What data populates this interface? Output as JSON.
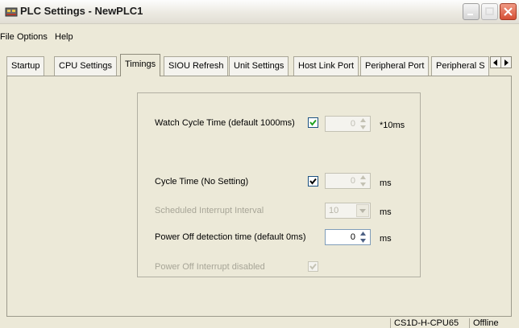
{
  "window": {
    "title": "PLC Settings - NewPLC1"
  },
  "menu": [
    "File",
    "Options",
    "Help"
  ],
  "tabs": [
    "Startup",
    "CPU Settings",
    "Timings",
    "SIOU Refresh",
    "Unit Settings",
    "Host Link Port",
    "Peripheral Port",
    "Peripheral S"
  ],
  "active_tab": "Timings",
  "settings": {
    "watch_cycle": {
      "label": "Watch Cycle Time (default 1000ms)",
      "checked": true,
      "value": "0",
      "unit": "*10ms",
      "value_enabled": false
    },
    "cycle_time": {
      "label": "Cycle Time (No Setting)",
      "checked": true,
      "value": "0",
      "unit": "ms",
      "value_enabled": false
    },
    "scheduled_interrupt": {
      "label": "Scheduled Interrupt Interval",
      "value": "10",
      "unit": "ms",
      "enabled": false
    },
    "power_off_detection": {
      "label": "Power Off detection time (default 0ms)",
      "value": "0",
      "unit": "ms",
      "enabled": true
    },
    "power_off_interrupt": {
      "label": "Power Off Interrupt disabled",
      "checked": true,
      "enabled": false
    }
  },
  "status": {
    "plc_model": "CS1D-H-CPU65",
    "connection": "Offline"
  },
  "colors": {
    "window_bg": "#ece9d8",
    "close_button": "#d54f34",
    "checkbox_border": "#1c5180"
  }
}
